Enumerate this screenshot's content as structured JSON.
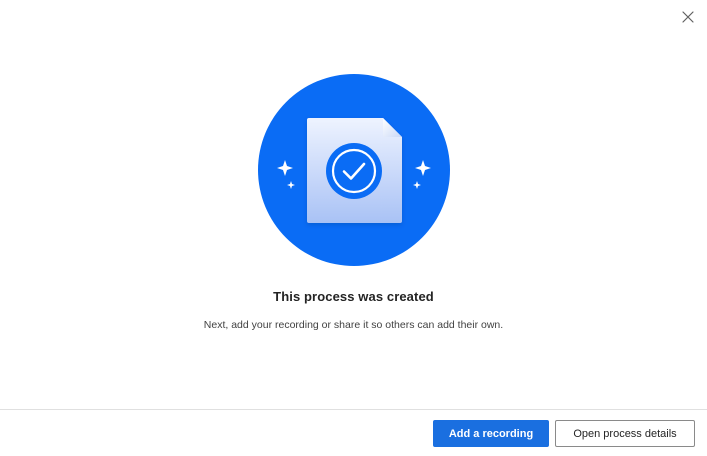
{
  "dialog": {
    "title": "This process was created",
    "subtitle": "Next, add your recording or share it so others can add their own.",
    "close_icon": "close-icon",
    "hero_icons": [
      "document-icon",
      "checkmark-icon",
      "sparkle-icon"
    ]
  },
  "footer": {
    "primary_label": "Add a recording",
    "secondary_label": "Open process details"
  },
  "colors": {
    "accent": "#1a6fe0",
    "hero_circle": "#0a6cf5"
  }
}
